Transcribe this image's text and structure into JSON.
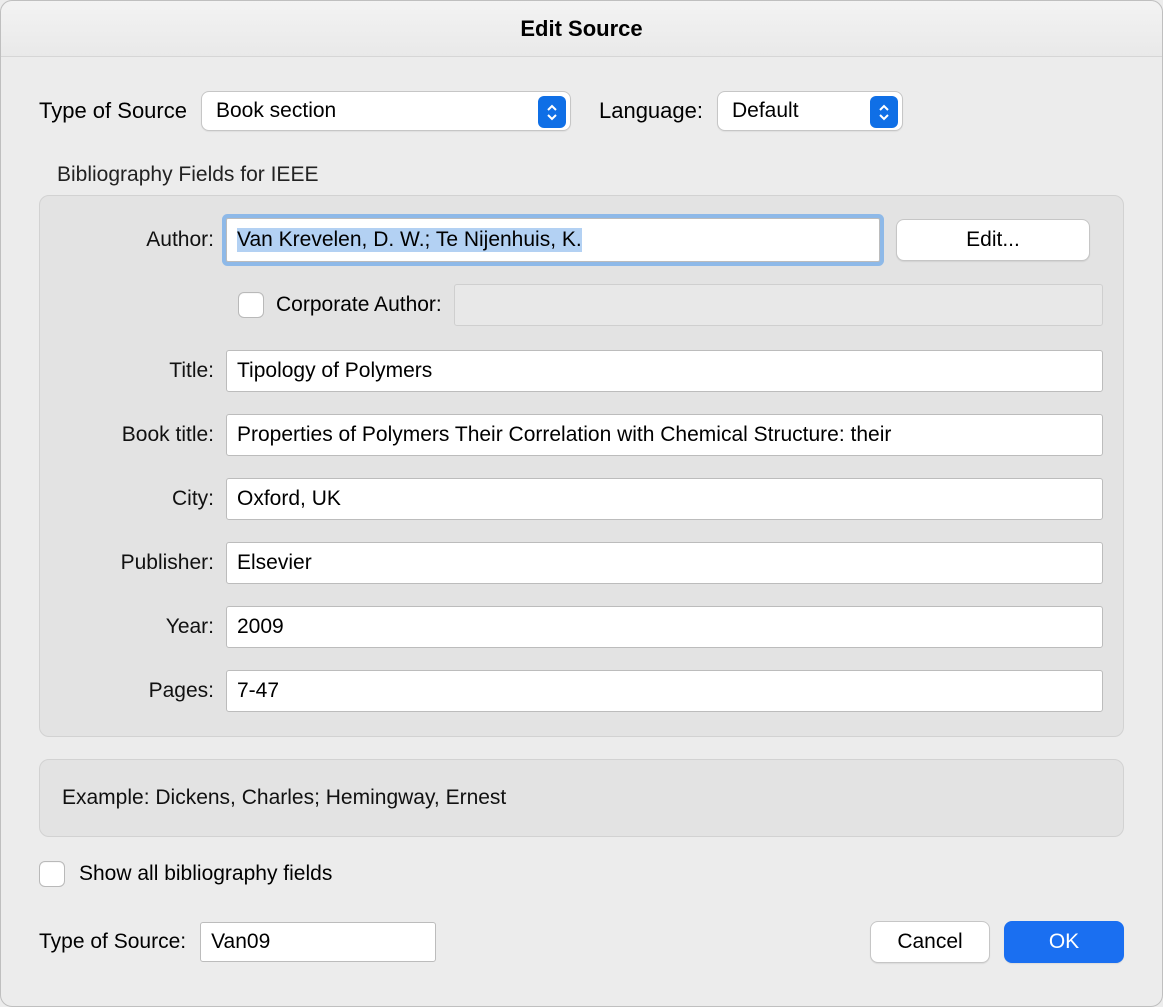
{
  "title": "Edit Source",
  "top": {
    "type_label": "Type of Source",
    "type_value": "Book section",
    "lang_label": "Language:",
    "lang_value": "Default"
  },
  "fieldset_label": "Bibliography Fields for IEEE",
  "fields": {
    "author_label": "Author:",
    "author_value": "Van Krevelen, D. W.; Te Nijenhuis, K.",
    "edit_button": "Edit...",
    "corporate_label": "Corporate Author:",
    "corporate_value": "",
    "title_label": "Title:",
    "title_value": "Tipology of Polymers",
    "booktitle_label": "Book title:",
    "booktitle_value": "Properties of Polymers Their Correlation with Chemical Structure: their",
    "city_label": "City:",
    "city_value": "Oxford, UK",
    "publisher_label": "Publisher:",
    "publisher_value": "Elsevier",
    "year_label": "Year:",
    "year_value": "2009",
    "pages_label": "Pages:",
    "pages_value": "7-47"
  },
  "example": "Example: Dickens, Charles; Hemingway, Ernest",
  "show_all_label": "Show all bibliography fields",
  "footer": {
    "tag_label": "Type of Source:",
    "tag_value": "Van09",
    "cancel": "Cancel",
    "ok": "OK"
  }
}
